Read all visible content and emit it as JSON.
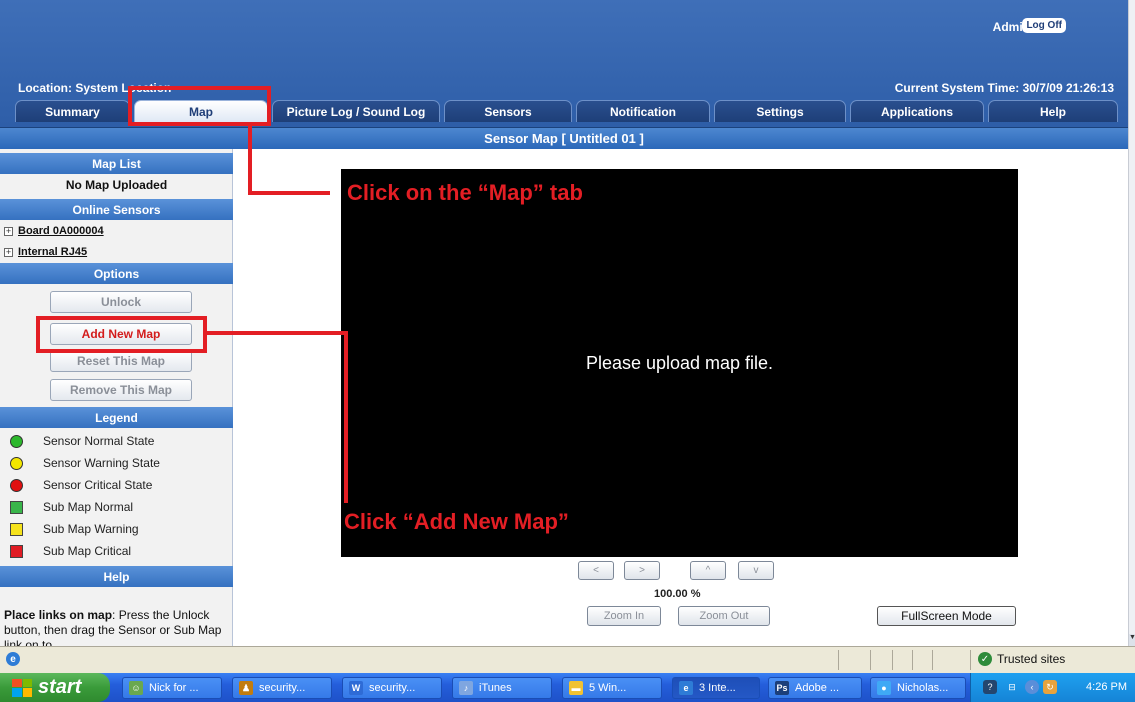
{
  "header": {
    "admin_label": "Admin",
    "logoff_label": "Log Off",
    "location_label": "Location: System Location",
    "current_time": "Current System Time: 30/7/09 21:26:13"
  },
  "tabs": [
    {
      "label": "Summary"
    },
    {
      "label": "Map"
    },
    {
      "label": "Picture Log / Sound Log"
    },
    {
      "label": "Sensors"
    },
    {
      "label": "Notification"
    },
    {
      "label": "Settings"
    },
    {
      "label": "Applications"
    },
    {
      "label": "Help"
    }
  ],
  "active_tab": "Map",
  "page_title": "Sensor Map [ Untitled 01 ]",
  "sidebar": {
    "map_list_heading": "Map List",
    "map_list_status": "No Map Uploaded",
    "online_sensors_heading": "Online Sensors",
    "sensors": [
      {
        "label": "Board 0A000004"
      },
      {
        "label": "Internal RJ45"
      }
    ],
    "options_heading": "Options",
    "options": [
      {
        "label": "Unlock"
      },
      {
        "label": "Add New Map"
      },
      {
        "label": "Reset This Map"
      },
      {
        "label": "Remove This Map"
      }
    ],
    "legend_heading": "Legend",
    "legend": [
      {
        "label": "Sensor Normal State",
        "color": "#2db82d",
        "shape": "circle"
      },
      {
        "label": "Sensor Warning State",
        "color": "#f2e600",
        "shape": "circle"
      },
      {
        "label": "Sensor Critical State",
        "color": "#e01010",
        "shape": "circle"
      },
      {
        "label": "Sub Map Normal",
        "color": "#39b54a",
        "shape": "square"
      },
      {
        "label": "Sub Map Warning",
        "color": "#f5e21c",
        "shape": "square"
      },
      {
        "label": "Sub Map Critical",
        "color": "#e01c24",
        "shape": "square"
      }
    ],
    "help_heading": "Help",
    "help_bold": "Place links on map",
    "help_text": ": Press the Unlock button, then drag the Sensor or Sub Map link on to"
  },
  "map": {
    "placeholder": "Please upload map file.",
    "nav": [
      "<",
      ">",
      "^",
      "v"
    ],
    "zoom_level": "100.00 %",
    "zoom_in_label": "Zoom In",
    "zoom_out_label": "Zoom Out",
    "fullscreen_label": "FullScreen Mode"
  },
  "annotations": {
    "map_tab_text": "Click on the “Map” tab",
    "add_map_text": "Click “Add New Map”",
    "color": "#e31e24"
  },
  "statusbar": {
    "zone_label": "Trusted sites"
  },
  "taskbar": {
    "start_label": "start",
    "items": [
      {
        "label": "Nick for ...",
        "icon": "messenger-icon",
        "color": "#6aa84f"
      },
      {
        "label": "security...",
        "icon": "people-icon",
        "color": "#c27c0e"
      },
      {
        "label": "security...",
        "icon": "document-icon",
        "color": "#2e6bd6"
      },
      {
        "label": "iTunes",
        "icon": "itunes-icon",
        "color": "#7fa6e0"
      },
      {
        "label": "5 Win...",
        "icon": "folder-icon",
        "color": "#f1c232"
      },
      {
        "label": "3 Inte...",
        "icon": "ie-icon",
        "color": "#2e7cd6"
      },
      {
        "label": "Adobe ...",
        "icon": "photoshop-icon",
        "color": "#1c3f7a"
      },
      {
        "label": "Nicholas...",
        "icon": "chat-icon",
        "color": "#3fa9f5"
      }
    ],
    "clock": "4:26 PM"
  }
}
